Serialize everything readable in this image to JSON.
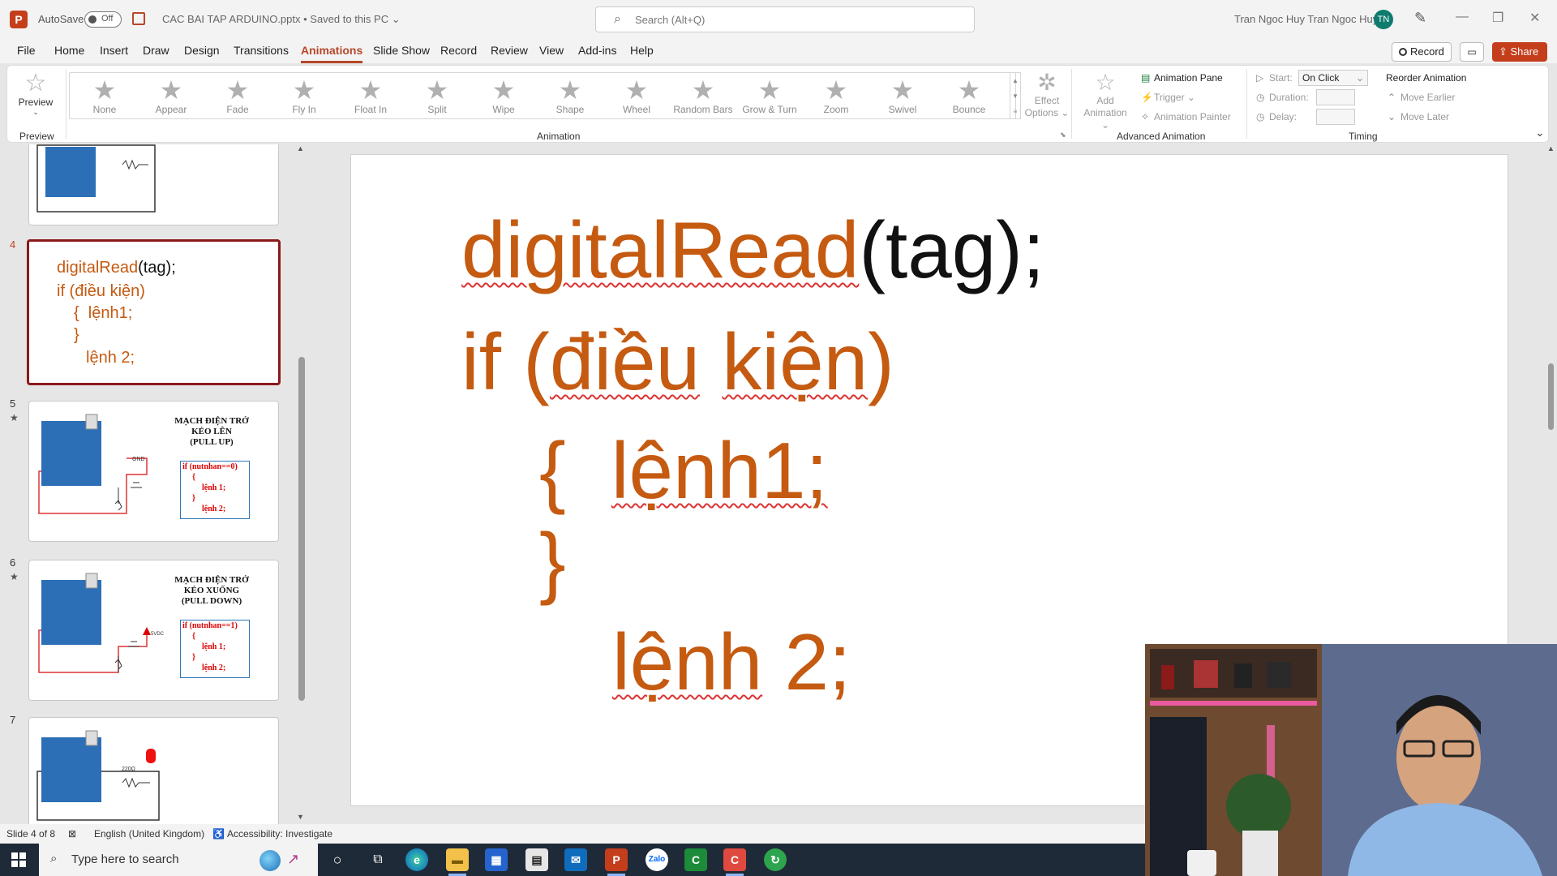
{
  "titlebar": {
    "logo": "P",
    "autosave_label": "AutoSave",
    "autosave_state": "Off",
    "file_name": "CAC BAI TAP ARDUINO.pptx • Saved to this PC ⌄",
    "search_placeholder": "Search (Alt+Q)",
    "user_name": "Tran Ngoc Huy Tran Ngoc Huy",
    "avatar_initials": "TN",
    "accent": "#c43e1c"
  },
  "menu": {
    "items": [
      "File",
      "Home",
      "Insert",
      "Draw",
      "Design",
      "Transitions",
      "Animations",
      "Slide Show",
      "Record",
      "Review",
      "View",
      "Add-ins",
      "Help"
    ],
    "active": "Animations",
    "record_label": "Record",
    "share_label": "Share"
  },
  "ribbon": {
    "preview_label": "Preview",
    "preview_group": "Preview",
    "animations": [
      "None",
      "Appear",
      "Fade",
      "Fly In",
      "Float In",
      "Split",
      "Wipe",
      "Shape",
      "Wheel",
      "Random Bars",
      "Grow & Turn",
      "Zoom",
      "Swivel",
      "Bounce"
    ],
    "effect_options": [
      "Effect",
      "Options ⌄"
    ],
    "animation_group": "Animation",
    "add_animation": [
      "Add",
      "Animation ⌄"
    ],
    "animation_pane": "Animation Pane",
    "trigger": "Trigger ⌄",
    "animation_painter": "Animation Painter",
    "advanced_group": "Advanced Animation",
    "start_label": "Start:",
    "start_value": "On Click",
    "duration_label": "Duration:",
    "delay_label": "Delay:",
    "reorder_title": "Reorder Animation",
    "move_earlier": "Move Earlier",
    "move_later": "Move Later",
    "timing_group": "Timing"
  },
  "thumbnails": [
    {
      "num": "",
      "star": ""
    },
    {
      "num": "4",
      "star": "",
      "lines": [
        "digitalRead",
        "(tag);",
        "if (điều kiện)",
        "{  lệnh1;",
        "}",
        "lệnh 2;"
      ]
    },
    {
      "num": "5",
      "star": "★",
      "title": [
        "MẠCH ĐIỆN TRỞ",
        "KÉO LÊN",
        "(PULL UP)"
      ],
      "code": [
        "if (nutnhan==0)",
        "{",
        "lệnh 1;",
        "}",
        "lệnh 2;"
      ],
      "label": "GND"
    },
    {
      "num": "6",
      "star": "★",
      "title": [
        "MẠCH ĐIỆN TRỞ",
        "KÉO XUỐNG",
        "(PULL DOWN)"
      ],
      "code": [
        "if (nutnhan==1)",
        "{",
        "lệnh 1;",
        "}",
        "lệnh 2;"
      ],
      "label": "5VDC"
    },
    {
      "num": "7",
      "star": "",
      "label": "220Ω"
    }
  ],
  "slide": {
    "fn_name": "digitalRead",
    "fn_args": "(tag);",
    "if_kw": "if (",
    "cond_a": "điều",
    "cond_b": "kiện",
    "if_close": ")",
    "brace_open": "{",
    "stmt1": "lệnh1;",
    "brace_close": "}",
    "stmt2_a": "lệnh",
    "stmt2_b": " 2;",
    "code_color": "#c55a11"
  },
  "status": {
    "slide_of": "Slide 4 of 8",
    "language": "English (United Kingdom)",
    "accessibility": "Accessibility: Investigate"
  },
  "taskbar": {
    "search_placeholder": "Type here to search"
  }
}
